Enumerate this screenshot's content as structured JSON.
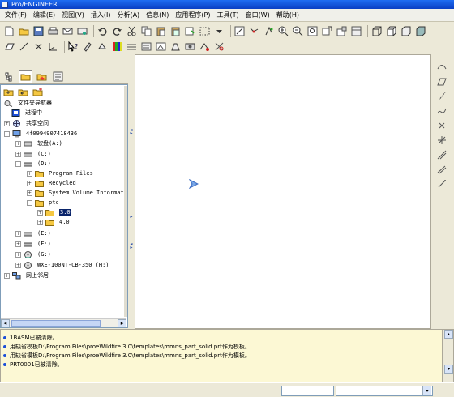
{
  "window": {
    "title": "Pro/ENGINEER"
  },
  "menu": [
    "文件(F)",
    "编辑(E)",
    "视图(V)",
    "插入(I)",
    "分析(A)",
    "信息(N)",
    "应用程序(P)",
    "工具(T)",
    "窗口(W)",
    "帮助(H)"
  ],
  "navigator": {
    "tabs": [
      "model-tree-tab",
      "folder-browser-tab",
      "favorites-tab",
      "history-tab"
    ],
    "header": "文件夹导航器",
    "items": {
      "in_session": "进程中",
      "shared_space": "共享空间",
      "computer": "4f0994907418436",
      "floppy": "软盘(A:)",
      "drive_c": "(C:)",
      "drive_d": "(D:)",
      "program_files": "Program Files",
      "recycled": "Recycled",
      "svi": "System Volume Informati",
      "ptc": "ptc",
      "v30": "3.0",
      "v40": "4.0",
      "drive_e": "(E:)",
      "drive_f": "(F:)",
      "drive_g": "(G:)",
      "drive_h": "WXE-100NT-CB-350 (H:)",
      "network": "网上邻居"
    }
  },
  "messages": [
    "1BASM已被清除。",
    "用缺省模板D:\\Program Files\\proeWildfire 3.0\\templates\\mmns_part_solid.prt作为模板。",
    "用缺省模板D:\\Program Files\\proeWildfire 3.0\\templates\\mmns_part_solid.prt作为模板。",
    "PRT0001已被清除。"
  ],
  "colors": {
    "accent": "#0a246a",
    "message_bg": "#fcf8d4",
    "folder": "#f5c842"
  }
}
